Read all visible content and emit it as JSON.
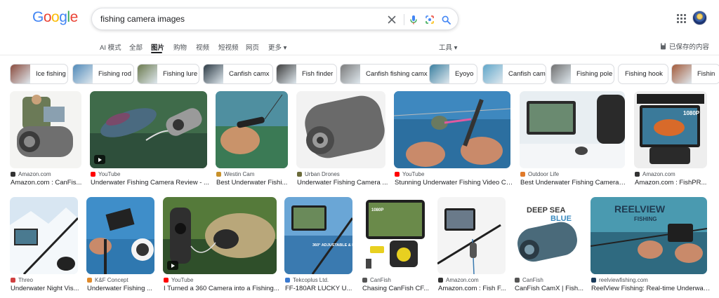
{
  "header": {
    "logo_letters": [
      {
        "ch": "G",
        "color": "#4285F4"
      },
      {
        "ch": "o",
        "color": "#EA4335"
      },
      {
        "ch": "o",
        "color": "#FBBC05"
      },
      {
        "ch": "g",
        "color": "#4285F4"
      },
      {
        "ch": "l",
        "color": "#34A853"
      },
      {
        "ch": "e",
        "color": "#EA4335"
      }
    ],
    "query": "fishing camera images",
    "icons": [
      "clear-icon",
      "microphone-icon",
      "lens-icon",
      "search-icon"
    ]
  },
  "tabs": {
    "items": [
      "AI 模式",
      "全部",
      "图片",
      "购物",
      "视频",
      "短视频",
      "网页",
      "更多 ▾"
    ],
    "active_index": 2,
    "tools_label": "工具 ▾",
    "saved_label": "已保存的内容"
  },
  "chips": [
    {
      "label": "Ice fishing",
      "thumb": "#8a4a3c"
    },
    {
      "label": "Fishing rod",
      "thumb": "#4f89b8"
    },
    {
      "label": "Fishing lure",
      "thumb": "#6b7a4e"
    },
    {
      "label": "Canfish camx",
      "thumb": "#2c3a44"
    },
    {
      "label": "Fish finder",
      "thumb": "#3d3d3d"
    },
    {
      "label": "Canfish fishing camx",
      "thumb": "#7a7a7a"
    },
    {
      "label": "Eyoyo",
      "thumb": "#3a7fa0"
    },
    {
      "label": "Canfish cam",
      "thumb": "#5fa6c9"
    },
    {
      "label": "Fishing pole",
      "thumb": "#6f6f6f"
    },
    {
      "label": "Fishing hook",
      "thumb": ""
    },
    {
      "label": "Fishin",
      "thumb": "#a35a3a"
    }
  ],
  "row1": [
    {
      "source": "Amazon.com",
      "title": "Amazon.com : CanFis...",
      "fav": "#333333",
      "video": false
    },
    {
      "source": "YouTube",
      "title": "Underwater Fishing Camera Review - ...",
      "fav": "#ff0000",
      "video": true
    },
    {
      "source": "Westin Cam",
      "title": "Best Underwater Fishi...",
      "fav": "#c8912a",
      "video": false
    },
    {
      "source": "Urban Drones",
      "title": "Underwater Fishing Camera ...",
      "fav": "#6b6b3a",
      "video": false
    },
    {
      "source": "YouTube",
      "title": "Stunning Underwater Fishing Video Ca...",
      "fav": "#ff0000",
      "video": false
    },
    {
      "source": "Outdoor Life",
      "title": "Best Underwater Fishing Cameras ...",
      "fav": "#e07a2a",
      "video": false
    },
    {
      "source": "Amazon.com",
      "title": "Amazon.com : FishPR...",
      "fav": "#333333",
      "video": false
    }
  ],
  "row2": [
    {
      "source": "Threo",
      "title": "Underwater Night Vis...",
      "fav": "#d04040",
      "video": false
    },
    {
      "source": "K&F Concept",
      "title": "Underwater Fishing ...",
      "fav": "#e08a2a",
      "video": false
    },
    {
      "source": "YouTube",
      "title": "I Turned a 360 Camera into a Fishing...",
      "fav": "#ff0000",
      "video": true
    },
    {
      "source": "Tekcoplus Ltd.",
      "title": "FF-180AR LUCKY U...",
      "fav": "#3a7ad0",
      "video": false
    },
    {
      "source": "CanFish",
      "title": "Chasing CanFish CF...",
      "fav": "#555555",
      "video": false
    },
    {
      "source": "Amazon.com",
      "title": "Amazon.com : Fish F...",
      "fav": "#333333",
      "video": false
    },
    {
      "source": "CanFish",
      "title": "CanFish CamX | Fish...",
      "fav": "#555555",
      "video": false
    },
    {
      "source": "reelviewfishing.com",
      "title": "ReelView Fishing: Real-time Underwat...",
      "fav": "#1a3a5a",
      "video": false
    }
  ],
  "image_texts": {
    "deep_sea": "DEEP SEA",
    "blue": "BLUE",
    "reelview": "REELVIEW",
    "fishing": "FISHING",
    "res_1080p": "1080P",
    "tekco_caption": "360° ADJUSTABLE & EASY INSTALLATION"
  },
  "colors": {
    "link_text": "#202124",
    "secondary_text": "#4d5156",
    "border": "#dadce0"
  }
}
